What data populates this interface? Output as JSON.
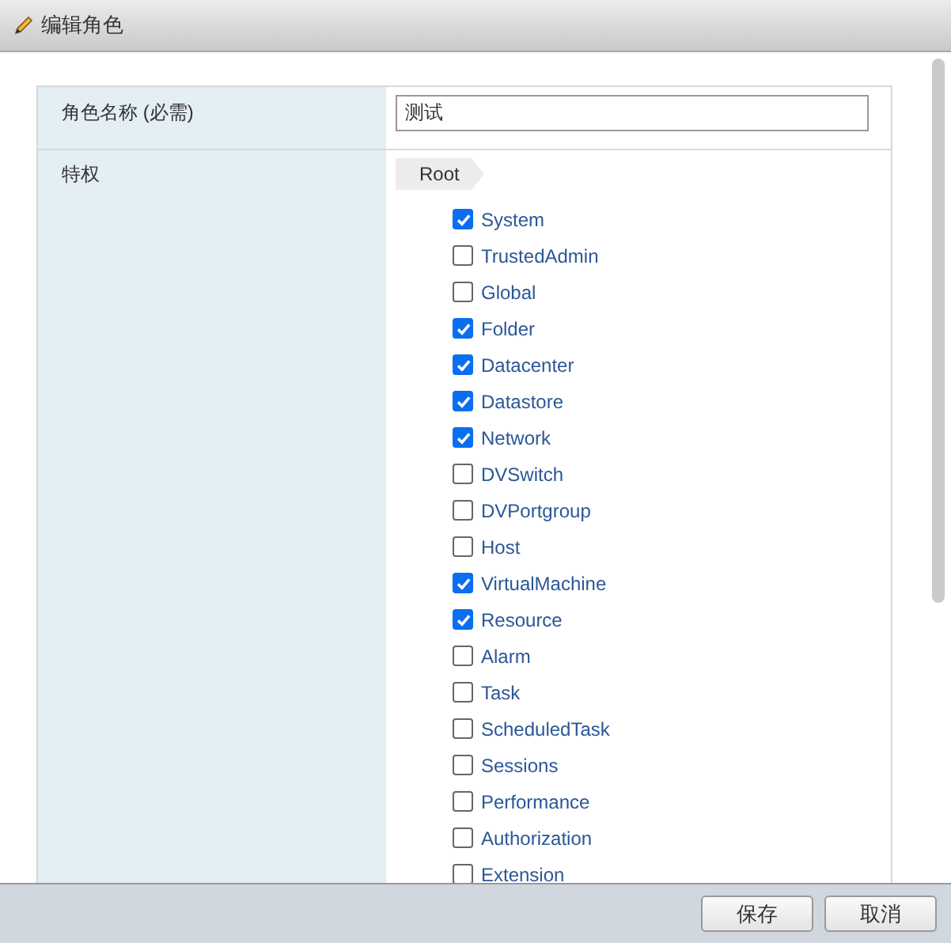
{
  "window": {
    "title": "编辑角色"
  },
  "form": {
    "name_label": "角色名称 (必需)",
    "name_value": "测试",
    "privileges_label": "特权",
    "breadcrumb": "Root",
    "privileges": [
      {
        "label": "System",
        "checked": true
      },
      {
        "label": "TrustedAdmin",
        "checked": false
      },
      {
        "label": "Global",
        "checked": false
      },
      {
        "label": "Folder",
        "checked": true
      },
      {
        "label": "Datacenter",
        "checked": true
      },
      {
        "label": "Datastore",
        "checked": true
      },
      {
        "label": "Network",
        "checked": true
      },
      {
        "label": "DVSwitch",
        "checked": false
      },
      {
        "label": "DVPortgroup",
        "checked": false
      },
      {
        "label": "Host",
        "checked": false
      },
      {
        "label": "VirtualMachine",
        "checked": true
      },
      {
        "label": "Resource",
        "checked": true
      },
      {
        "label": "Alarm",
        "checked": false
      },
      {
        "label": "Task",
        "checked": false
      },
      {
        "label": "ScheduledTask",
        "checked": false
      },
      {
        "label": "Sessions",
        "checked": false
      },
      {
        "label": "Performance",
        "checked": false
      },
      {
        "label": "Authorization",
        "checked": false
      },
      {
        "label": "Extension",
        "checked": false
      }
    ]
  },
  "buttons": [
    "保存",
    "取消"
  ]
}
